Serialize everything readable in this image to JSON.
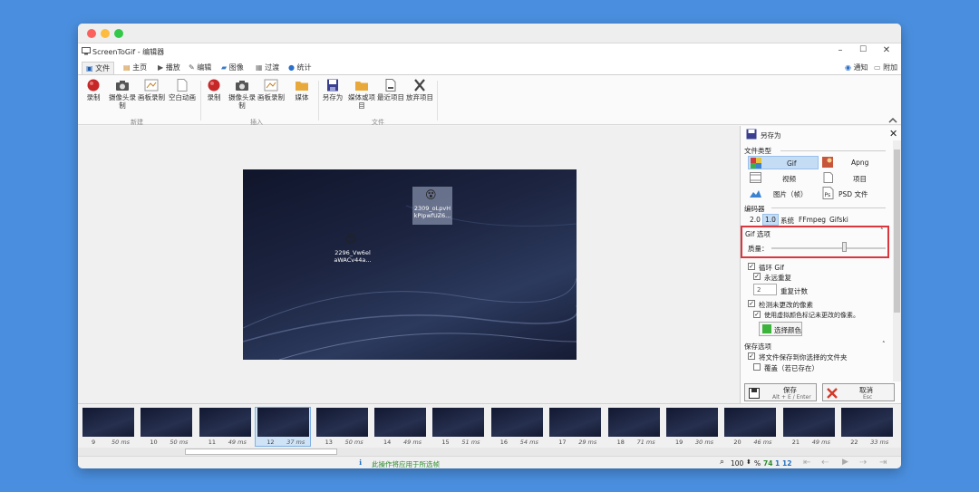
{
  "window": {
    "title": "ScreenToGif - 编辑器"
  },
  "top_right": {
    "notify": "通知",
    "extras": "附加"
  },
  "tabs": [
    {
      "label": "文件"
    },
    {
      "label": "主页"
    },
    {
      "label": "播放"
    },
    {
      "label": "编辑"
    },
    {
      "label": "图像"
    },
    {
      "label": "过渡"
    },
    {
      "label": "统计"
    }
  ],
  "ribbon": {
    "new_group": "新建",
    "insert_group": "插入",
    "file_group": "文件",
    "buttons": {
      "record": "录制",
      "webcam": "摄像头录制",
      "board": "画板录制",
      "blank": "空白动画",
      "record2": "录制",
      "webcam2": "摄像头录制",
      "board2": "画板录制",
      "media": "媒体",
      "save_as": "另存为",
      "media_or_project": "媒体或项目",
      "recent": "最近项目",
      "discard": "放弃项目"
    }
  },
  "canvas": {
    "icon1_label": "2309_oLpvH kPIpwfUZ6...",
    "icon2_label": "2296_Vw6el aWACv44a..."
  },
  "panel": {
    "title": "另存为",
    "file_type_label": "文件类型",
    "types": {
      "gif": "Gif",
      "apng": "Apng",
      "video": "视频",
      "project": "项目",
      "images": "图片（帧）",
      "psd": "PSD 文件"
    },
    "encoder_label": "编码器",
    "encoders": [
      "2.0",
      "1.0",
      "系统",
      "FFmpeg",
      "Gifski"
    ],
    "gif_options_label": "Gif 选项",
    "quality_label": "质量：",
    "quality": 0.62,
    "loop_gif": "循环 Gif",
    "forever": "永远重复",
    "repeat_count_value": "2",
    "repeat_count": "重复计数",
    "detect_unchanged": "检测未更改的像素",
    "use_chroma": "使用虚拟颜色标记未更改的像素。",
    "pick_color": "选择颜色",
    "chroma_color": "#3cb43c",
    "save_options_label": "保存选项",
    "save_to_folder": "将文件保存到你选择的文件夹",
    "overwrite": "覆盖（若已存在）",
    "save_button": "保存",
    "save_shortcut": "Alt + E / Enter",
    "cancel_button": "取消",
    "cancel_shortcut": "Esc"
  },
  "frames": [
    {
      "num": "9",
      "ms": "50 ms"
    },
    {
      "num": "10",
      "ms": "50 ms"
    },
    {
      "num": "11",
      "ms": "49 ms"
    },
    {
      "num": "12",
      "ms": "37 ms"
    },
    {
      "num": "13",
      "ms": "50 ms"
    },
    {
      "num": "14",
      "ms": "49 ms"
    },
    {
      "num": "15",
      "ms": "51 ms"
    },
    {
      "num": "16",
      "ms": "54 ms"
    },
    {
      "num": "17",
      "ms": "29 ms"
    },
    {
      "num": "18",
      "ms": "71 ms"
    },
    {
      "num": "19",
      "ms": "30 ms"
    },
    {
      "num": "20",
      "ms": "46 ms"
    },
    {
      "num": "21",
      "ms": "49 ms"
    },
    {
      "num": "22",
      "ms": "33 ms"
    }
  ],
  "status": {
    "message": "此操作将应用于所选帧",
    "zoom": "100",
    "percent": "%",
    "frame_count": "74",
    "selected": "1",
    "current": "12"
  }
}
